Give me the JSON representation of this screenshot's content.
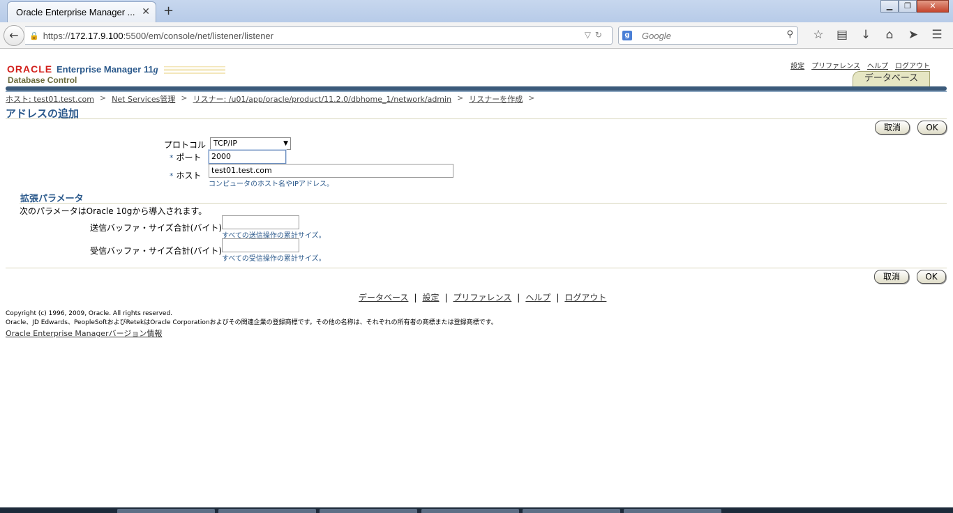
{
  "browser": {
    "tab_title": "Oracle Enterprise Manager ...",
    "tab_close": "✕",
    "new_tab": "+",
    "url_scheme": "https://",
    "url_host": "172.17.9.100",
    "url_path": ":5500/em/console/net/listener/listener",
    "search_engine_letter": "g",
    "search_placeholder": "Google",
    "window_buttons": [
      "▁",
      "❐",
      "✕"
    ],
    "icons": [
      "star-icon",
      "bookmarks-icon",
      "download-icon",
      "home-icon",
      "send-icon",
      "menu-icon"
    ]
  },
  "em": {
    "logo_oracle": "ORACLE",
    "logo_em": "Enterprise Manager 11",
    "logo_version": "g",
    "logo_sub": "Database Control",
    "global_links": [
      "設定",
      "プリファレンス",
      "ヘルプ",
      "ログアウト"
    ],
    "db_tab": "データベース"
  },
  "breadcrumb": [
    "ホスト: test01.test.com",
    "Net Services管理",
    "リスナー: /u01/app/oracle/product/11.2.0/dbhome_1/network/admin",
    "リスナーを作成"
  ],
  "breadcrumb_sep": ">",
  "page": {
    "title": "アドレスの追加",
    "cancel_label": "取消",
    "ok_label": "OK"
  },
  "form": {
    "protocol_label": "プロトコル",
    "protocol_value": "TCP/IP",
    "required_mark": "*",
    "port_label": "ポート",
    "port_value": "2000",
    "host_label": "ホスト",
    "host_value": "test01.test.com",
    "host_hint": "コンピュータのホスト名やIPアドレス。"
  },
  "advanced": {
    "title": "拡張パラメータ",
    "description": "次のパラメータはOracle 10gから導入されます。",
    "send_label": "送信バッファ・サイズ合計(バイト)",
    "send_value": "",
    "send_hint": "すべての送信操作の累計サイズ。",
    "recv_label": "受信バッファ・サイズ合計(バイト)",
    "recv_value": "",
    "recv_hint": "すべての受信操作の累計サイズ。"
  },
  "footer": {
    "links": [
      "データベース",
      "設定",
      "プリファレンス",
      "ヘルプ",
      "ログアウト"
    ],
    "separator": "|",
    "copyright_line1": "Copyright (c) 1996, 2009, Oracle. All rights reserved.",
    "copyright_line2": "Oracle、JD Edwards、PeopleSoftおよびRetekはOracle Corporationおよびその関連企業の登録商標です。その他の名称は、それぞれの所有者の商標または登録商標です。",
    "version_link": "Oracle Enterprise Managerバージョン情報"
  }
}
